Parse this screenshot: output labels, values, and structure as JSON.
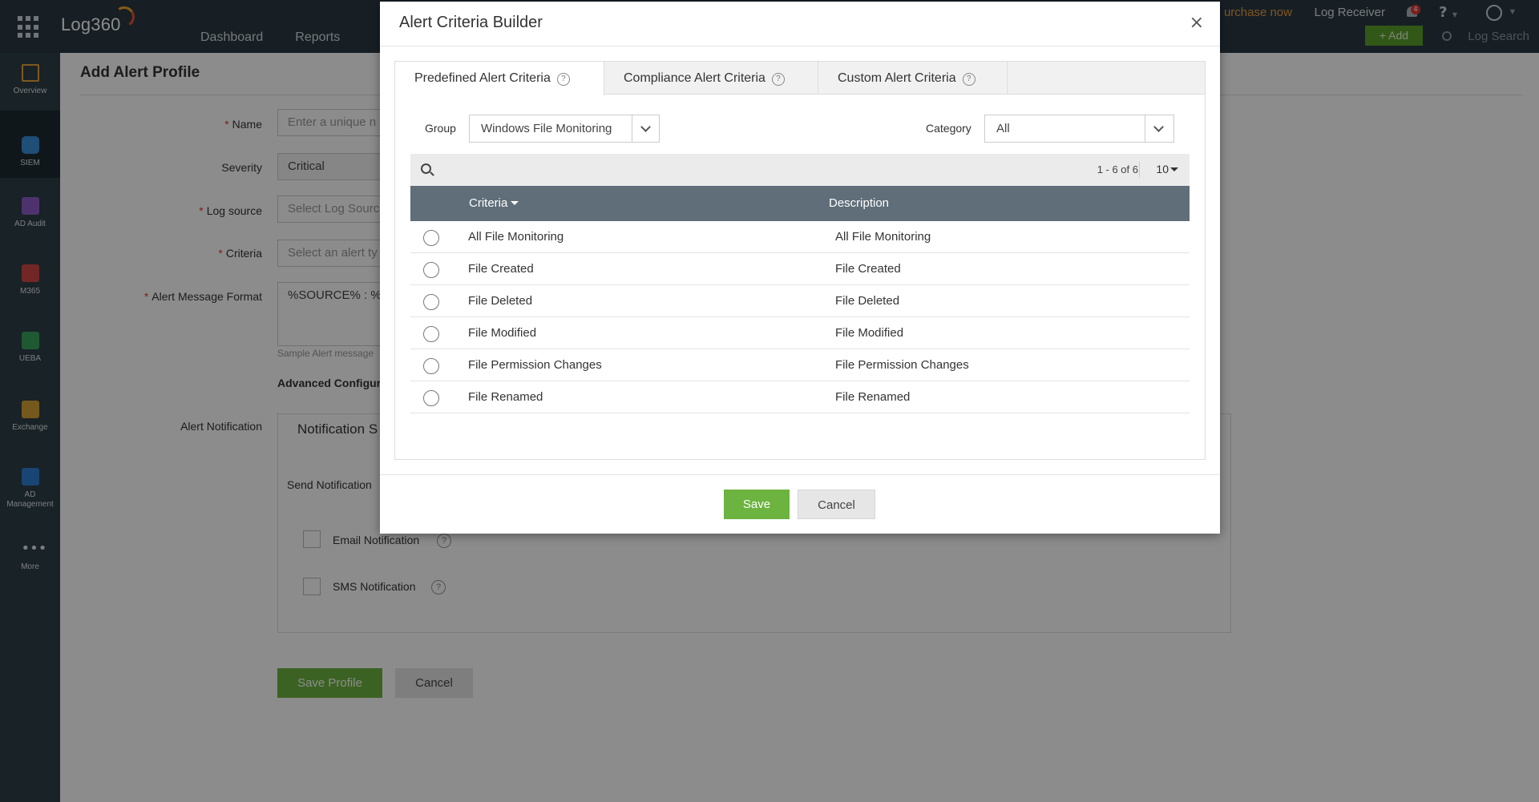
{
  "app": {
    "logo": "Log360",
    "nav": [
      "Dashboard",
      "Reports"
    ],
    "purchase": "urchase now",
    "log_receiver": "Log Receiver",
    "notification_count": "4",
    "help": "?",
    "add_label": "+ Add",
    "log_search_placeholder": "Log Search"
  },
  "sidebar": {
    "items": [
      {
        "label": "Overview",
        "icon": "overview-icon",
        "color": "#e8a33b"
      },
      {
        "label": "SIEM",
        "icon": "siem-shield-icon",
        "color": "#3a8fd8"
      },
      {
        "label": "AD Audit",
        "icon": "ad-audit-icon",
        "color": "#8e5bc7"
      },
      {
        "label": "M365",
        "icon": "m365-icon",
        "color": "#d14545"
      },
      {
        "label": "UEBA",
        "icon": "ueba-eye-icon",
        "color": "#3aa35c"
      },
      {
        "label": "Exchange",
        "icon": "exchange-mail-icon",
        "color": "#d6a233"
      },
      {
        "label": "AD Management",
        "icon": "ad-management-icon",
        "color": "#2c7fd1"
      },
      {
        "label": "More",
        "icon": "more-dots-icon",
        "color": "#dfe5e9"
      }
    ]
  },
  "page": {
    "title": "Add Alert Profile",
    "fields": {
      "name_label": "Name",
      "name_placeholder": "Enter a unique n",
      "severity_label": "Severity",
      "severity_value": "Critical",
      "log_source_label": "Log source",
      "log_source_placeholder": "Select Log Sourc",
      "criteria_label": "Criteria",
      "criteria_placeholder": "Select an alert ty",
      "message_format_label": "Alert Message Format",
      "message_format_value": "%SOURCE% : %N",
      "sample_alert": "Sample Alert message",
      "advanced": "Advanced Configur"
    },
    "notification": {
      "label": "Alert Notification",
      "tab": "Notification S",
      "send": "Send Notification",
      "email": "Email Notification",
      "sms": "SMS Notification"
    },
    "save_profile": "Save Profile",
    "cancel": "Cancel"
  },
  "modal": {
    "title": "Alert Criteria Builder",
    "close": "×",
    "tabs": [
      {
        "label": "Predefined Alert Criteria",
        "active": true
      },
      {
        "label": "Compliance Alert Criteria",
        "active": false
      },
      {
        "label": "Custom Alert Criteria",
        "active": false
      }
    ],
    "group_label": "Group",
    "group_value": "Windows File Monitoring",
    "category_label": "Category",
    "category_value": "All",
    "pagination": "1 - 6 of 6",
    "page_size": "10",
    "columns": {
      "criteria": "Criteria",
      "description": "Description"
    },
    "rows": [
      {
        "criteria": "All File Monitoring",
        "description": "All File Monitoring"
      },
      {
        "criteria": "File Created",
        "description": "File Created"
      },
      {
        "criteria": "File Deleted",
        "description": "File Deleted"
      },
      {
        "criteria": "File Modified",
        "description": "File Modified"
      },
      {
        "criteria": "File Permission Changes",
        "description": "File Permission Changes"
      },
      {
        "criteria": "File Renamed",
        "description": "File Renamed"
      }
    ],
    "save": "Save",
    "cancel": "Cancel"
  }
}
